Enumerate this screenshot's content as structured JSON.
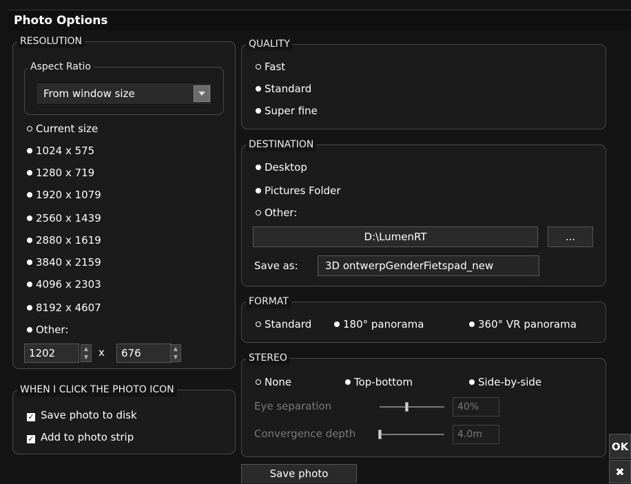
{
  "window": {
    "title": "Photo Options"
  },
  "resolution": {
    "legend": "RESOLUTION",
    "aspect_legend": "Aspect Ratio",
    "aspect_value": "From window size",
    "options": [
      {
        "label": "Current size",
        "selected": false
      },
      {
        "label": "1024 x 575",
        "selected": true
      },
      {
        "label": "1280 x 719",
        "selected": true
      },
      {
        "label": "1920 x 1079",
        "selected": true
      },
      {
        "label": "2560 x 1439",
        "selected": true
      },
      {
        "label": "2880 x 1619",
        "selected": true
      },
      {
        "label": "3840 x 2159",
        "selected": true
      },
      {
        "label": "4096 x 2303",
        "selected": true
      },
      {
        "label": "8192 x 4607",
        "selected": true
      },
      {
        "label": "Other:",
        "selected": true
      }
    ],
    "width_value": "1202",
    "times": "x",
    "height_value": "676"
  },
  "when_click": {
    "legend": "WHEN I CLICK THE PHOTO ICON",
    "save_to_disk": "Save photo to disk",
    "add_to_strip": "Add to photo strip",
    "check_mark": "☑"
  },
  "quality": {
    "legend": "QUALITY",
    "options": [
      {
        "label": "Fast",
        "selected": false
      },
      {
        "label": "Standard",
        "selected": true
      },
      {
        "label": "Super fine",
        "selected": true
      }
    ]
  },
  "destination": {
    "legend": "DESTINATION",
    "options": [
      {
        "label": "Desktop",
        "selected": true
      },
      {
        "label": "Pictures Folder",
        "selected": true
      },
      {
        "label": "Other:",
        "selected": false
      }
    ],
    "path": "D:\\LumenRT",
    "browse": "...",
    "save_as_label": "Save as:",
    "save_as_value": "3D ontwerpGenderFietspad_new"
  },
  "format": {
    "legend": "FORMAT",
    "options": [
      {
        "label": "Standard",
        "selected": false
      },
      {
        "label": "180° panorama",
        "selected": true
      },
      {
        "label": "360° VR panorama",
        "selected": true
      }
    ]
  },
  "stereo": {
    "legend": "STEREO",
    "options": [
      {
        "label": "None",
        "selected": false
      },
      {
        "label": "Top-bottom",
        "selected": true
      },
      {
        "label": "Side-by-side",
        "selected": true
      }
    ],
    "eye_label": "Eye separation",
    "eye_value": "40%",
    "eye_level": 0.4,
    "conv_label": "Convergence depth",
    "conv_value": "4.0m",
    "conv_level": 0.0
  },
  "save_button": "Save photo",
  "side": {
    "ok": "OK",
    "close": "✖"
  },
  "colors": {
    "background": "#141414",
    "panel": "#1b1b1b",
    "disabled_text": "#7a7a7a"
  }
}
